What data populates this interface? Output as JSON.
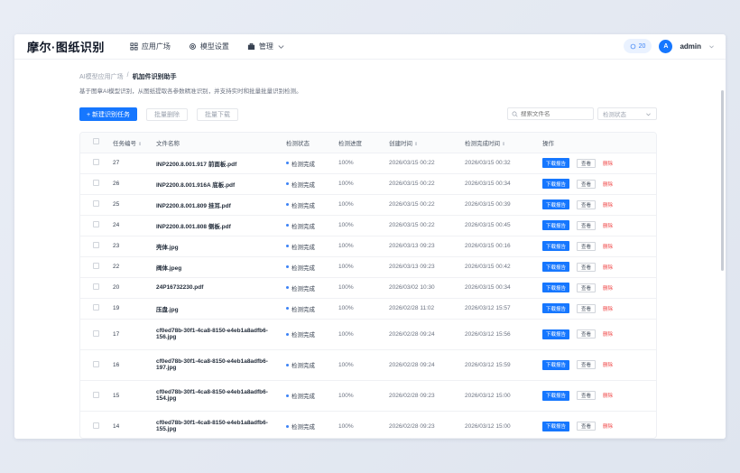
{
  "app": {
    "brand": "摩尔·图纸识别",
    "nav": [
      {
        "label": "应用广场",
        "icon": "grid-icon"
      },
      {
        "label": "模型设置",
        "icon": "gear-icon"
      },
      {
        "label": "管理",
        "icon": "briefcase-icon"
      }
    ],
    "credits": "20",
    "avatar_letter": "A",
    "user": "admin"
  },
  "page": {
    "breadcrumb_parent": "AI模型应用广场",
    "breadcrumb_sep": "/",
    "breadcrumb_current": "机加件识别助手",
    "description": "基于图章AI模型识别，从图纸提取各参数精准识别，并支持实时和批量批量识别检测。",
    "new_button": "+ 新建识别任务",
    "batch_delete": "批量删除",
    "batch_download": "批量下载",
    "search_placeholder": "搜索文件名",
    "status_filter": "检测状态"
  },
  "table": {
    "headers": {
      "id": "任务编号",
      "file": "文件名称",
      "status": "检测状态",
      "progress": "检测进度",
      "created": "创建时间",
      "finished": "检测完成时间",
      "ops": "操作"
    },
    "ops": {
      "download": "下载报告",
      "view": "查看",
      "delete": "删除"
    },
    "rows": [
      {
        "id": "27",
        "file": "INP2200.8.001.917 前面板.pdf",
        "status": "检测完成",
        "progress": "100%",
        "created": "2026/03/15 00:22",
        "finished": "2026/03/15 00:32"
      },
      {
        "id": "26",
        "file": "INP2200.8.001.916A 底板.pdf",
        "status": "检测完成",
        "progress": "100%",
        "created": "2026/03/15 00:22",
        "finished": "2026/03/15 00:34"
      },
      {
        "id": "25",
        "file": "INP2200.8.001.809 挂耳.pdf",
        "status": "检测完成",
        "progress": "100%",
        "created": "2026/03/15 00:22",
        "finished": "2026/03/15 00:39"
      },
      {
        "id": "24",
        "file": "INP2200.8.001.808 侧板.pdf",
        "status": "检测完成",
        "progress": "100%",
        "created": "2026/03/15 00:22",
        "finished": "2026/03/15 00:45"
      },
      {
        "id": "23",
        "file": "壳体.jpg",
        "status": "检测完成",
        "progress": "100%",
        "created": "2026/03/13 09:23",
        "finished": "2026/03/15 00:16"
      },
      {
        "id": "22",
        "file": "阀体.jpeg",
        "status": "检测完成",
        "progress": "100%",
        "created": "2026/03/13 09:23",
        "finished": "2026/03/15 00:42"
      },
      {
        "id": "20",
        "file": "24P16732230.pdf",
        "status": "检测完成",
        "progress": "100%",
        "created": "2026/03/02 10:30",
        "finished": "2026/03/15 00:34"
      },
      {
        "id": "19",
        "file": "压盘.jpg",
        "status": "检测完成",
        "progress": "100%",
        "created": "2026/02/28 11:02",
        "finished": "2026/03/12 15:57"
      },
      {
        "id": "17",
        "file": "cf0ed78b-30f1-4ca8-8150-e4eb1a8adfb6-156.jpg",
        "status": "检测完成",
        "progress": "100%",
        "created": "2026/02/28 09:24",
        "finished": "2026/03/12 15:56"
      },
      {
        "id": "16",
        "file": "cf0ed78b-30f1-4ca8-8150-e4eb1a8adfb6-197.jpg",
        "status": "检测完成",
        "progress": "100%",
        "created": "2026/02/28 09:24",
        "finished": "2026/03/12 15:59"
      },
      {
        "id": "15",
        "file": "cf0ed78b-30f1-4ca8-8150-e4eb1a8adfb6-154.jpg",
        "status": "检测完成",
        "progress": "100%",
        "created": "2026/02/28 09:23",
        "finished": "2026/03/12 15:00"
      },
      {
        "id": "14",
        "file": "cf0ed78b-30f1-4ca8-8150-e4eb1a8adfb6-155.jpg",
        "status": "检测完成",
        "progress": "100%",
        "created": "2026/02/28 09:23",
        "finished": "2026/03/12 15:00"
      }
    ]
  }
}
